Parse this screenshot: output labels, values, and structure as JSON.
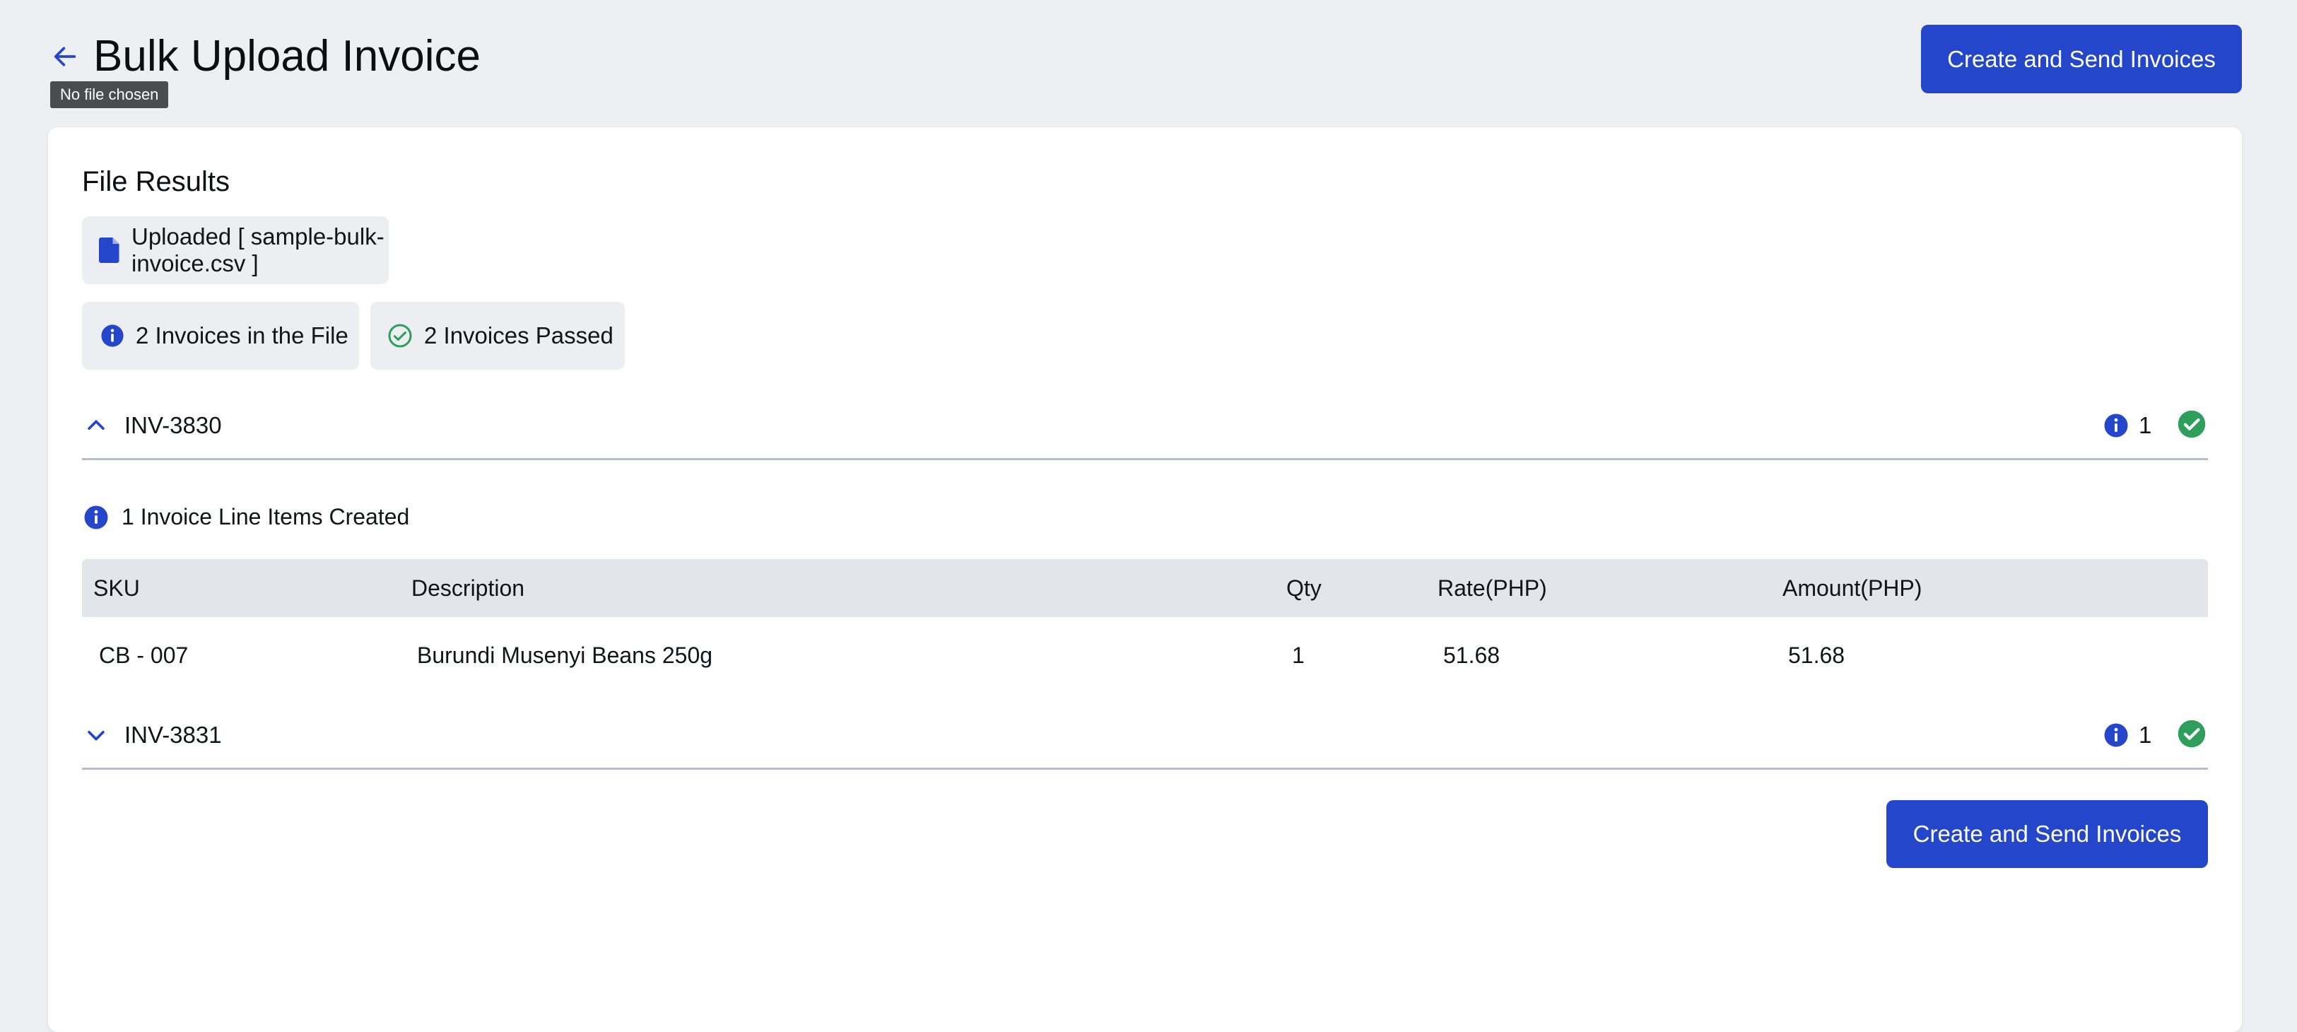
{
  "header": {
    "title": "Bulk Upload Invoice",
    "tooltip": "No file chosen",
    "primary_button": "Create and Send Invoices"
  },
  "results": {
    "title": "File Results",
    "uploaded_label": "Uploaded [ sample-bulk-invoice.csv ]",
    "invoice_count_label": "2 Invoices in the File",
    "passed_label": "2 Invoices Passed"
  },
  "invoices": [
    {
      "id": "INV-3830",
      "expanded": true,
      "info_count": "1",
      "line_items_label": "1 Invoice Line Items Created",
      "table": {
        "columns": [
          "SKU",
          "Description",
          "Qty",
          "Rate(PHP)",
          "Amount(PHP)"
        ],
        "rows": [
          [
            "CB - 007",
            "Burundi Musenyi Beans 250g",
            "1",
            "51.68",
            "51.68"
          ]
        ]
      }
    },
    {
      "id": "INV-3831",
      "expanded": false,
      "info_count": "1"
    }
  ],
  "footer": {
    "primary_button": "Create and Send Invoices"
  },
  "colors": {
    "accent": "#2446cb",
    "success": "#2e9e5b",
    "background": "#eeeff3"
  }
}
